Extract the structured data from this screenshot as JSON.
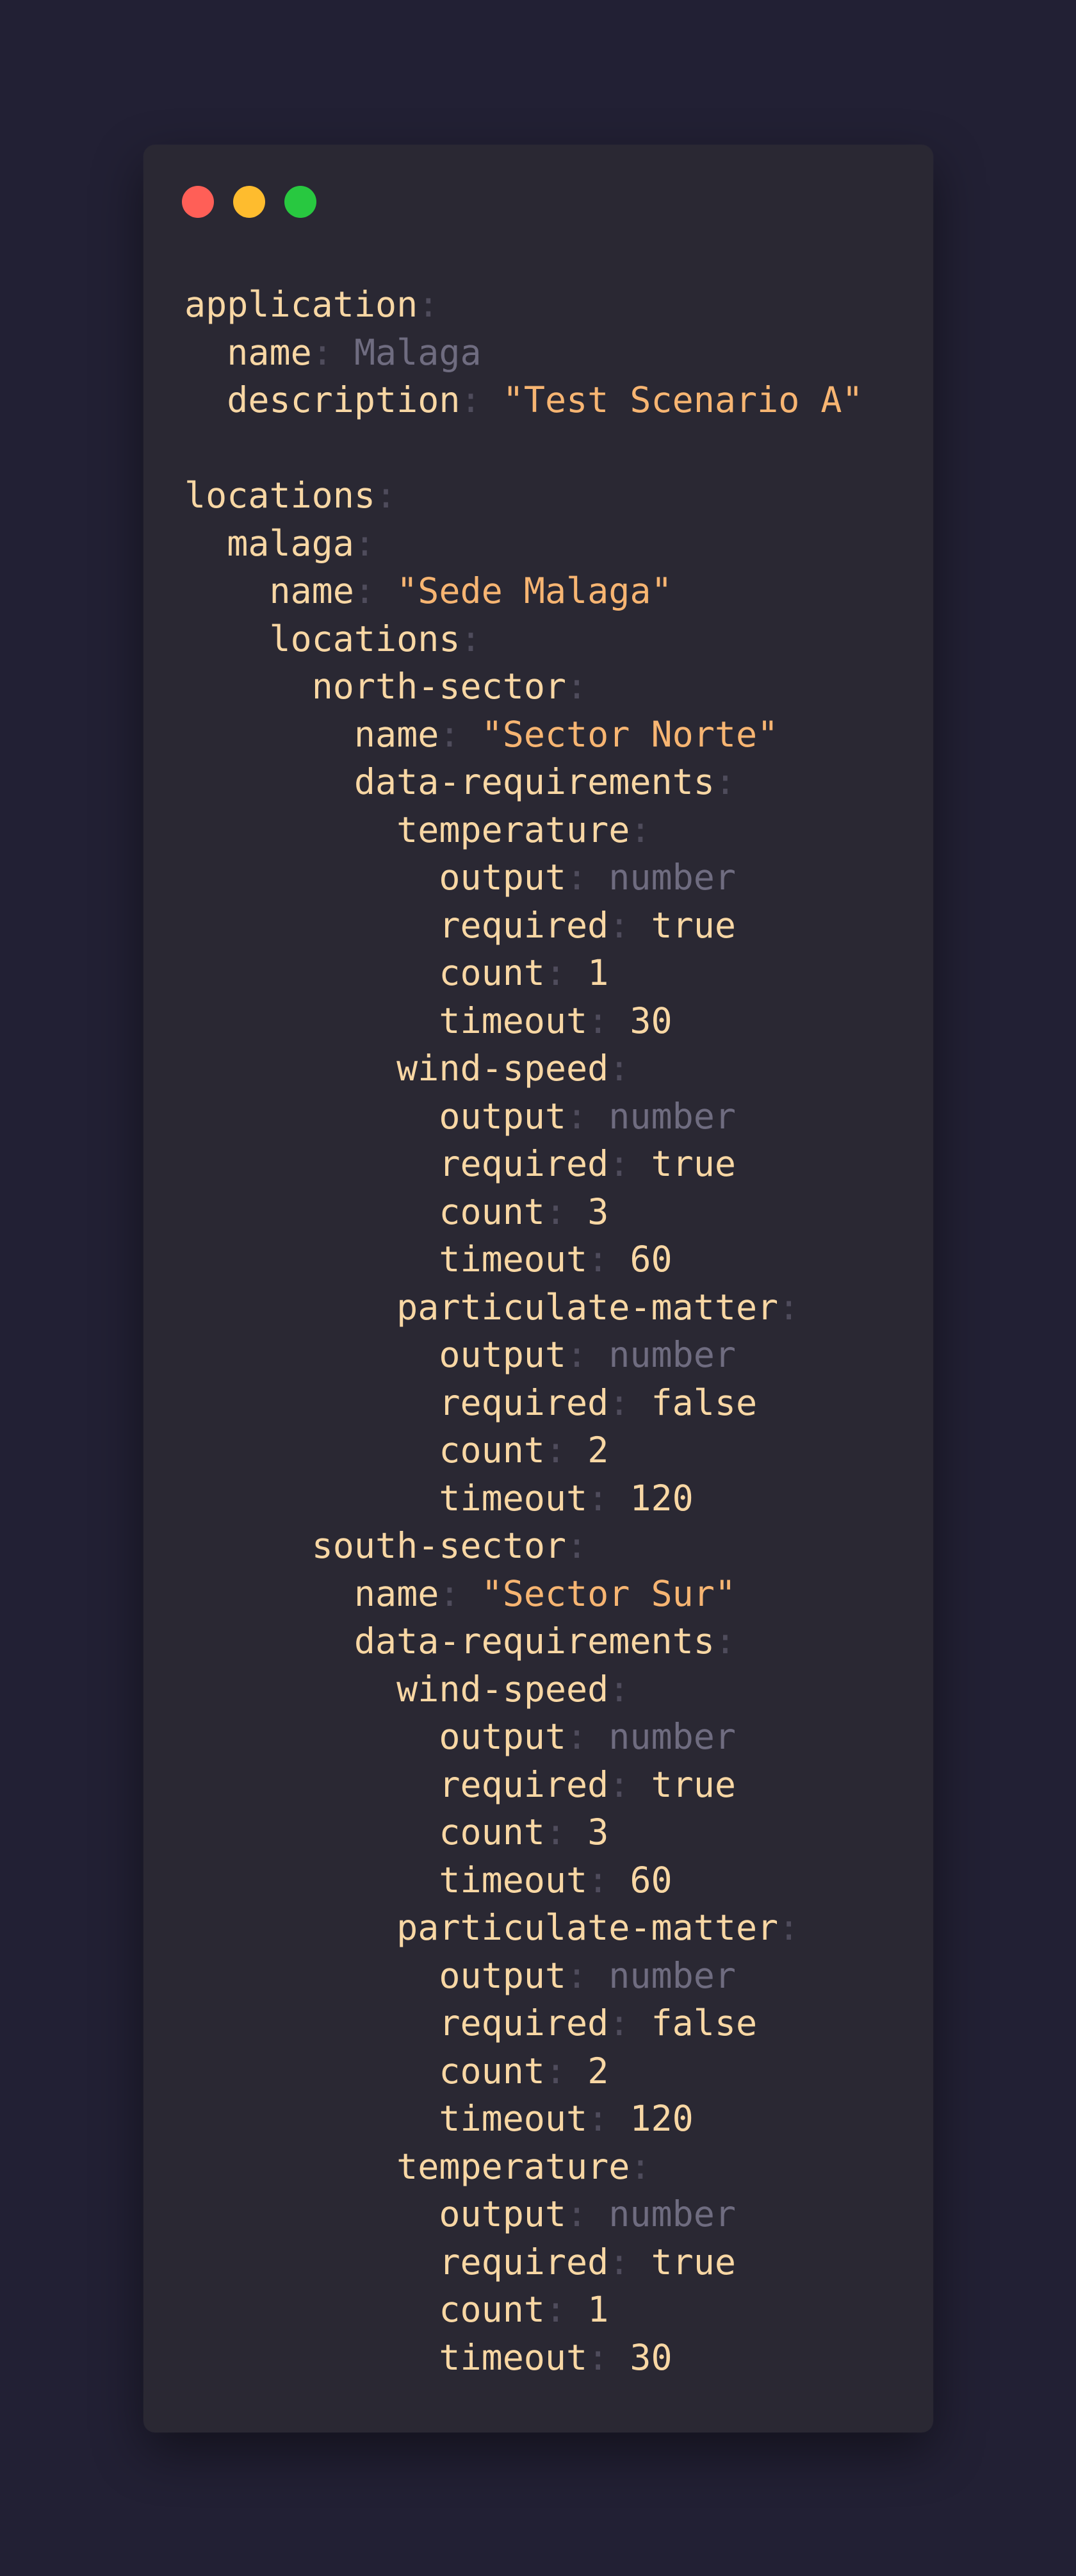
{
  "window": {
    "controls": [
      "close",
      "minimize",
      "maximize"
    ],
    "colors": {
      "close": "#ff5f57",
      "minimize": "#febc2e",
      "maximize": "#28c840"
    }
  },
  "lines": [
    {
      "indent": 0,
      "key": "application"
    },
    {
      "indent": 1,
      "key": "name",
      "value": "Malaga",
      "vtype": "muted"
    },
    {
      "indent": 1,
      "key": "description",
      "value": "\"Test Scenario A\"",
      "vtype": "string"
    },
    {
      "blank": true
    },
    {
      "indent": 0,
      "key": "locations"
    },
    {
      "indent": 1,
      "key": "malaga"
    },
    {
      "indent": 2,
      "key": "name",
      "value": "\"Sede Malaga\"",
      "vtype": "string"
    },
    {
      "indent": 2,
      "key": "locations"
    },
    {
      "indent": 3,
      "key": "north-sector"
    },
    {
      "indent": 4,
      "key": "name",
      "value": "\"Sector Norte\"",
      "vtype": "string"
    },
    {
      "indent": 4,
      "key": "data-requirements"
    },
    {
      "indent": 5,
      "key": "temperature"
    },
    {
      "indent": 6,
      "key": "output",
      "value": "number",
      "vtype": "muted"
    },
    {
      "indent": 6,
      "key": "required",
      "value": "true",
      "vtype": "value"
    },
    {
      "indent": 6,
      "key": "count",
      "value": "1",
      "vtype": "value"
    },
    {
      "indent": 6,
      "key": "timeout",
      "value": "30",
      "vtype": "value"
    },
    {
      "indent": 5,
      "key": "wind-speed"
    },
    {
      "indent": 6,
      "key": "output",
      "value": "number",
      "vtype": "muted"
    },
    {
      "indent": 6,
      "key": "required",
      "value": "true",
      "vtype": "value"
    },
    {
      "indent": 6,
      "key": "count",
      "value": "3",
      "vtype": "value"
    },
    {
      "indent": 6,
      "key": "timeout",
      "value": "60",
      "vtype": "value"
    },
    {
      "indent": 5,
      "key": "particulate-matter"
    },
    {
      "indent": 6,
      "key": "output",
      "value": "number",
      "vtype": "muted"
    },
    {
      "indent": 6,
      "key": "required",
      "value": "false",
      "vtype": "value"
    },
    {
      "indent": 6,
      "key": "count",
      "value": "2",
      "vtype": "value"
    },
    {
      "indent": 6,
      "key": "timeout",
      "value": "120",
      "vtype": "value"
    },
    {
      "indent": 3,
      "key": "south-sector"
    },
    {
      "indent": 4,
      "key": "name",
      "value": "\"Sector Sur\"",
      "vtype": "string"
    },
    {
      "indent": 4,
      "key": "data-requirements"
    },
    {
      "indent": 5,
      "key": "wind-speed"
    },
    {
      "indent": 6,
      "key": "output",
      "value": "number",
      "vtype": "muted"
    },
    {
      "indent": 6,
      "key": "required",
      "value": "true",
      "vtype": "value"
    },
    {
      "indent": 6,
      "key": "count",
      "value": "3",
      "vtype": "value"
    },
    {
      "indent": 6,
      "key": "timeout",
      "value": "60",
      "vtype": "value"
    },
    {
      "indent": 5,
      "key": "particulate-matter"
    },
    {
      "indent": 6,
      "key": "output",
      "value": "number",
      "vtype": "muted"
    },
    {
      "indent": 6,
      "key": "required",
      "value": "false",
      "vtype": "value"
    },
    {
      "indent": 6,
      "key": "count",
      "value": "2",
      "vtype": "value"
    },
    {
      "indent": 6,
      "key": "timeout",
      "value": "120",
      "vtype": "value"
    },
    {
      "indent": 5,
      "key": "temperature"
    },
    {
      "indent": 6,
      "key": "output",
      "value": "number",
      "vtype": "muted"
    },
    {
      "indent": 6,
      "key": "required",
      "value": "true",
      "vtype": "value"
    },
    {
      "indent": 6,
      "key": "count",
      "value": "1",
      "vtype": "value"
    },
    {
      "indent": 6,
      "key": "timeout",
      "value": "30",
      "vtype": "value"
    }
  ]
}
